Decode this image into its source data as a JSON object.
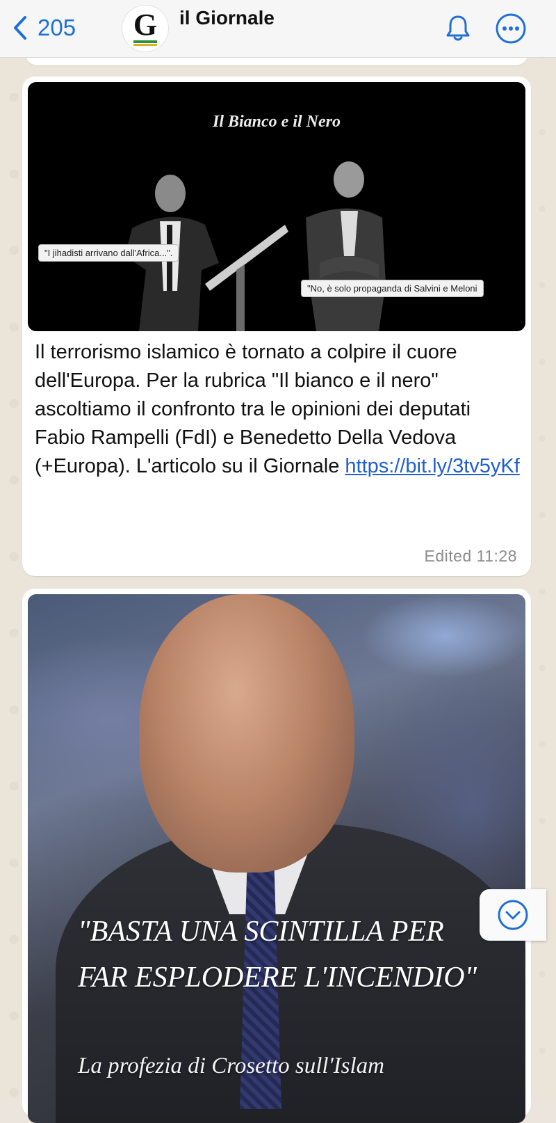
{
  "header": {
    "back_count": "205",
    "avatar_letter": "G",
    "title": "il Giornale",
    "accent_color": "#1f6fd6",
    "icons": [
      "chevron-left-icon",
      "bell-icon",
      "more-icon"
    ]
  },
  "messages": [
    {
      "image": {
        "title": "Il Bianco e il Nero",
        "quote_left": "\"I jihadisti arrivano dall'Africa...\".",
        "quote_right": "\"No, è solo propaganda di Salvini e Meloni"
      },
      "text": "Il terrorismo islamico è tornato a colpire il cuore dell'Europa. Per la rubrica \"Il bianco e il nero\" ascoltiamo il confronto tra le opinioni dei deputati Fabio Rampelli (FdI) e Benedetto Della Vedova (+Europa). L'articolo su il Giornale ",
      "link": "https://bit.ly/3tv5yKf",
      "status": "Edited",
      "time": "11:28"
    },
    {
      "image": {
        "headline": "\"BASTA UNA SCINTILLA PER FAR ESPLODERE L'INCENDIO\"",
        "subline": "La profezia di Crosetto sull'Islam"
      }
    }
  ]
}
